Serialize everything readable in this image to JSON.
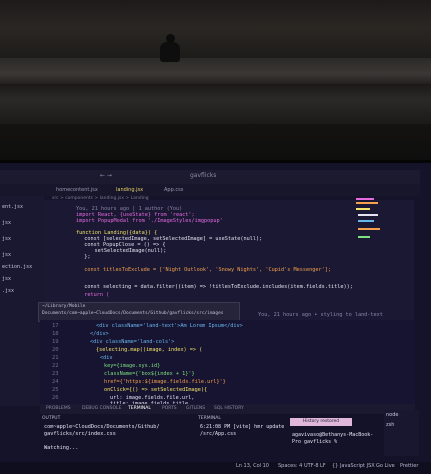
{
  "window": {
    "title": "gavflicks"
  },
  "tabs": [
    {
      "label": "homecontent.jsx"
    },
    {
      "label": "landing.jsx"
    },
    {
      "label": "App.css"
    }
  ],
  "breadcrumbs": "src > components > landing.jsx > Landing",
  "sidebar_items": [
    "ent.jsx",
    "jsx",
    "jsx",
    "jsx",
    "ection.jsx",
    "jsx",
    ".jsx"
  ],
  "blame_line": "You, 21 hours ago | 1 author (You)",
  "code_lines": [
    "import React, {useState} from 'react';",
    "import PopupModal from './ImageStyles/imgpopup'",
    "",
    "function Landing({data}) {",
    "  const [selectedImage, setSelectedImage] = useState(null);",
    "  const PopupClose = () => {",
    "    setSelectedImage(null);",
    "  };",
    "",
    "  const titlesToExclude = ['Night Outlook', 'Snowy Nights', 'Cupid's Messenger'];",
    "",
    "  const selecting = data.filter((item) => !titlesToExclude.includes(item.fields.title));",
    "  return ("
  ],
  "hover_path": [
    "~/Library/Mobile",
    "Documents/com~apple~CloudDocs/Documents/Github/gavflicks/src/images"
  ],
  "sticky": {
    "line_numbers": [
      "17",
      "18",
      "19",
      "20",
      "21",
      "22",
      "23",
      "24",
      "25",
      "26"
    ],
    "lines": [
      "<div className='land-text'>Am Lorem Ipsum</div>",
      "</div>",
      "<div className='land-cols'>",
      "{selecting.map((image, index) => (",
      "<div",
      "key={image.sys.id}",
      "className={'box${index + 1}'}",
      "href={'https:${image.fields.file.url}'}",
      "onClick={() => setSelectedImage({",
      "url: image.fields.file.url,",
      "title: image.fields.title"
    ],
    "inline_blame": "You, 21 hours ago • styling to land-text"
  },
  "panel_tabs": [
    "PROBLEMS",
    "DEBUG CONSOLE",
    "TERMINAL",
    "PORTS",
    "GITLENS",
    "SQL HISTORY"
  ],
  "output": {
    "title": "OUTPUT",
    "lines": [
      "com~apple~CloudDocs/Documents/Github/",
      "gavflicks/src/index.css",
      "",
      "Watching..."
    ]
  },
  "terminal": {
    "title": "TERMINAL",
    "history_badge": "History restored",
    "lines": [
      "6:21:08 PM [vite] hmr update",
      "/src/App.css",
      "agavivaso@Bethanys-MacBook-",
      "Pro gavflicks %"
    ]
  },
  "terminal_list": [
    "node",
    "zsh"
  ],
  "statusbar": [
    "Ln 13, Col 10",
    "Spaces: 4",
    "UTF-8",
    "LF",
    "{} JavaScript JSX",
    "Go Live",
    "Prettier"
  ],
  "colors": {
    "editor_bg": "#1a1833",
    "keyword": "#e56ae0",
    "string": "#f5a04e",
    "function": "#f5e36a",
    "active_tab": "#e9d36a"
  }
}
